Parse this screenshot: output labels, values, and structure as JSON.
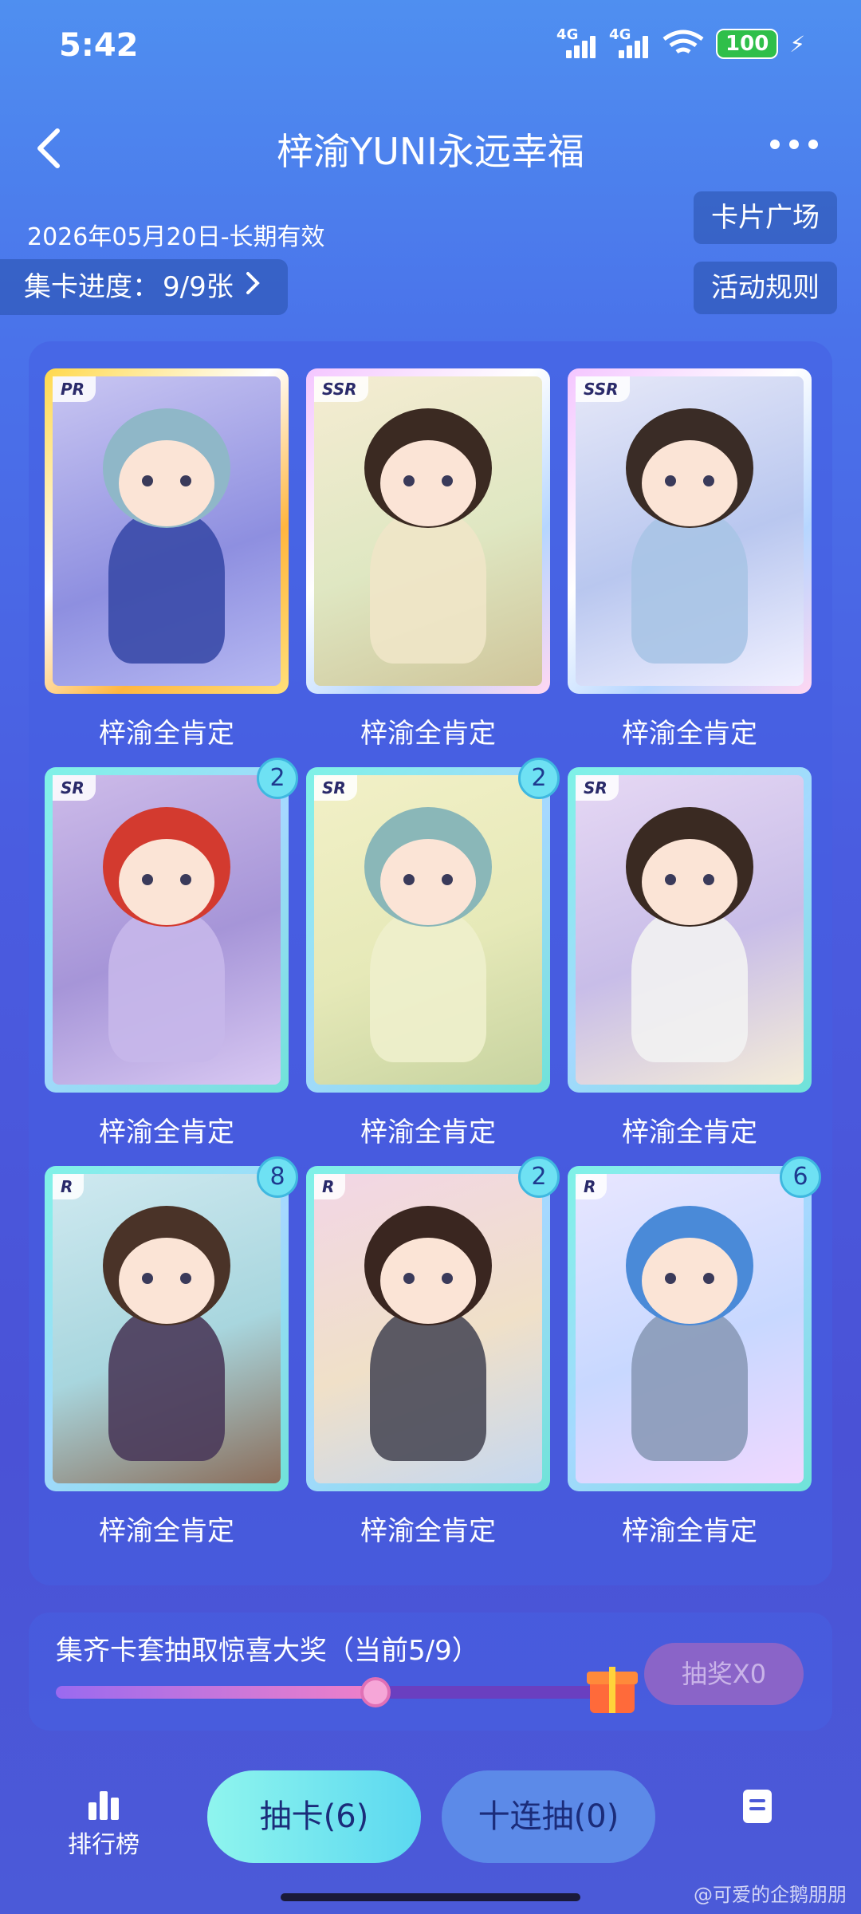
{
  "status_bar": {
    "time": "5:42",
    "net1": "4G",
    "net2": "4G",
    "battery": "100"
  },
  "nav": {
    "title": "梓渝YUNI永远幸福",
    "back_icon": "chevron-left-icon",
    "more_icon": "more-horizontal-icon"
  },
  "info": {
    "date": "2026年05月20日-长期有效",
    "progress_label": "集卡进度：",
    "progress_value": "9/9张",
    "card_plaza": "卡片广场",
    "rules": "活动规则"
  },
  "cards": [
    {
      "rarity": "PR",
      "name": "梓渝全肯定",
      "count": ""
    },
    {
      "rarity": "SSR",
      "name": "梓渝全肯定",
      "count": ""
    },
    {
      "rarity": "SSR",
      "name": "梓渝全肯定",
      "count": ""
    },
    {
      "rarity": "SR",
      "name": "梓渝全肯定",
      "count": "2"
    },
    {
      "rarity": "SR",
      "name": "梓渝全肯定",
      "count": "2"
    },
    {
      "rarity": "SR",
      "name": "梓渝全肯定",
      "count": ""
    },
    {
      "rarity": "R",
      "name": "梓渝全肯定",
      "count": "8"
    },
    {
      "rarity": "R",
      "name": "梓渝全肯定",
      "count": "2"
    },
    {
      "rarity": "R",
      "name": "梓渝全肯定",
      "count": "6"
    }
  ],
  "reward": {
    "text": "集齐卡套抽取惊喜大奖（当前5/9）",
    "progress": 0.59,
    "draw_prize": "抽奖X0"
  },
  "bottom": {
    "ranking": "排行榜",
    "draw": "抽卡(6)",
    "draw_ten": "十连抽(0)"
  },
  "watermark": "@可爱的企鹅朋朋",
  "colors": {
    "accent": "#6ee1f3",
    "background": "#4a5ce0"
  }
}
